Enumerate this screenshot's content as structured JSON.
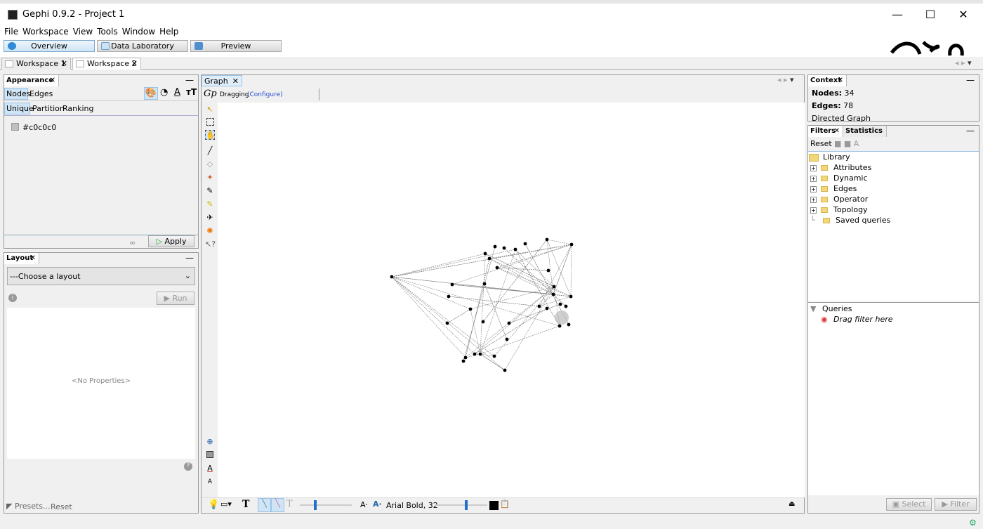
{
  "window": {
    "title": "Gephi 0.9.2 - Project 1",
    "minimize": "—",
    "maximize": "☐",
    "close": "✕"
  },
  "menu": [
    "File",
    "Workspace",
    "View",
    "Tools",
    "Window",
    "Help"
  ],
  "modes": [
    {
      "label": "Overview",
      "active": true
    },
    {
      "label": "Data Laboratory"
    },
    {
      "label": "Preview"
    }
  ],
  "workspaces": [
    {
      "label": "Workspace 1"
    },
    {
      "label": "Workspace 2",
      "active": true
    }
  ],
  "appearance": {
    "tab": "Appearance",
    "element_tabs": [
      "Nodes",
      "Edges"
    ],
    "mode_tabs": [
      "Unique",
      "Partition",
      "Ranking"
    ],
    "color_value": "#c0c0c0",
    "apply": "Apply"
  },
  "layout": {
    "tab": "Layout",
    "select": "---Choose a layout",
    "run": "Run",
    "no_properties": "<No Properties>",
    "presets": "Presets...",
    "reset": "Reset"
  },
  "graph": {
    "tab": "Graph",
    "mode": "Dragging",
    "configure": "(Configure)",
    "node_count": 34,
    "edge_count": 78,
    "node_color": "#000000",
    "edge_color": "#808080"
  },
  "bottom_toolbar": {
    "font": "Arial Bold, 32"
  },
  "context": {
    "tab": "Context",
    "nodes_label": "Nodes:",
    "nodes": "34",
    "edges_label": "Edges:",
    "edges": "78",
    "type": "Directed Graph"
  },
  "filters": {
    "tab": "Filters",
    "stats_tab": "Statistics",
    "reset": "Reset",
    "library": "Library",
    "categories": [
      "Attributes",
      "Dynamic",
      "Edges",
      "Operator",
      "Topology"
    ],
    "saved": "Saved queries",
    "queries": "Queries",
    "drag_hint": "Drag filter here",
    "select": "Select",
    "filter": "Filter"
  },
  "colors": {
    "accent": "#cfe4f4",
    "selection_blue": "#1f6fd0"
  }
}
